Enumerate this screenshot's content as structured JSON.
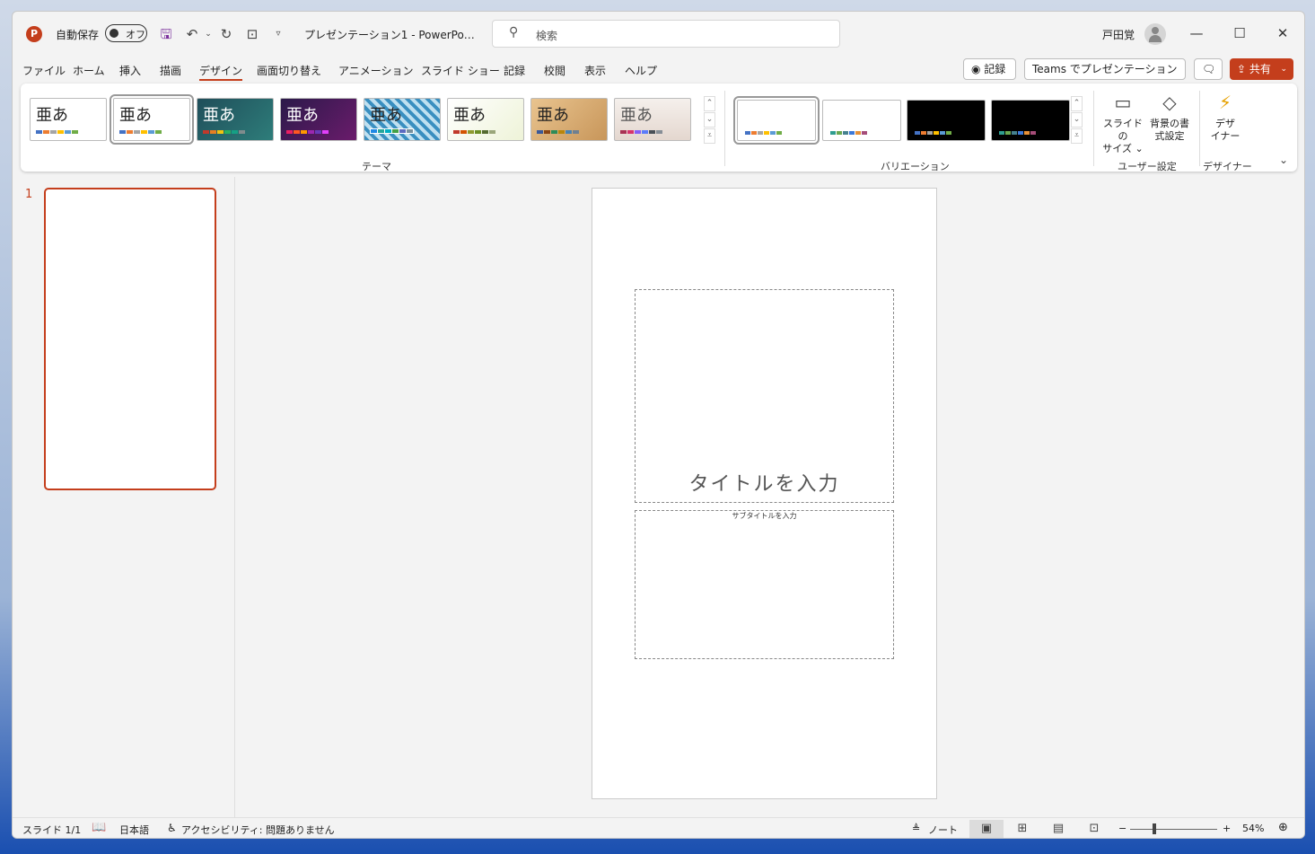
{
  "titlebar": {
    "app_logo": "P",
    "autosave_label": "自動保存",
    "autosave_state": "オフ",
    "doc_title": "プレゼンテーション1  -  PowerPo…",
    "search_placeholder": "検索",
    "user_name": "戸田覚"
  },
  "menu": {
    "items": [
      "ファイル",
      "ホーム",
      "挿入",
      "描画",
      "デザイン",
      "画面切り替え",
      "アニメーション",
      "スライド ショー",
      "記録",
      "校閲",
      "表示",
      "ヘルプ"
    ],
    "active": "デザイン",
    "record_button": "◉ 記録",
    "teams_button": "Teams でプレゼンテーション",
    "share_button": "共有"
  },
  "ribbon": {
    "themes_group_label": "テーマ",
    "theme_sample_text": "亜あ",
    "variations_group_label": "バリエーション",
    "user_settings_group_label": "ユーザー設定",
    "designer_group_label": "デザイナー",
    "slide_size_label_1": "スライドの",
    "slide_size_label_2": "サイズ ⌄",
    "bg_format_label_1": "背景の書",
    "bg_format_label_2": "式設定",
    "designer_label_1": "デザ",
    "designer_label_2": "イナー"
  },
  "slides": {
    "thumbnail_number": "1",
    "title_placeholder": "タイトルを入力",
    "subtitle_placeholder": "サブタイトルを入力"
  },
  "statusbar": {
    "slide_info": "スライド 1/1",
    "language": "日本語",
    "accessibility": "アクセシビリティ: 問題ありません",
    "notes": "ノート",
    "zoom_minus": "−",
    "zoom_plus": "+",
    "zoom_percent": "54%",
    "zoom_level": 0.54
  }
}
